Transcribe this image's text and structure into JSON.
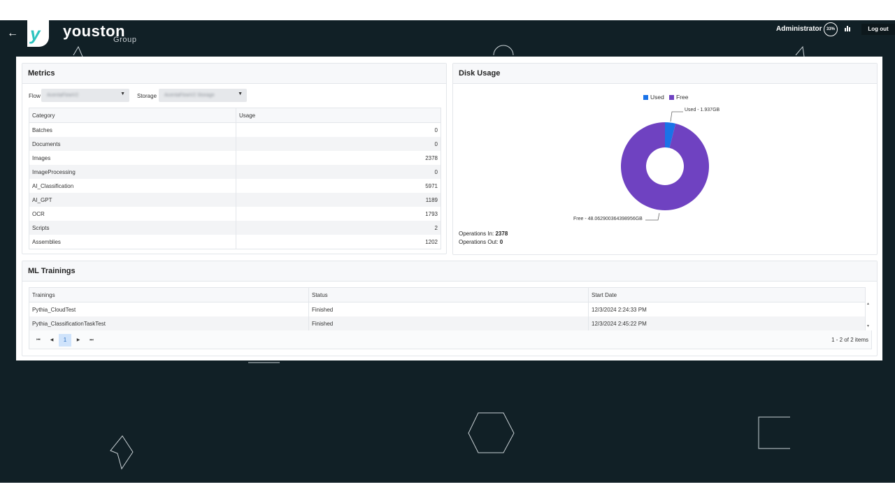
{
  "header": {
    "brand": "youston",
    "brand_sub": "Group",
    "user": "Administrator",
    "progress": "33%",
    "logout": "Log out"
  },
  "colors": {
    "app_bg": "#112026",
    "used": "#1a73e8",
    "free": "#6f42c1",
    "accent": "#2ec4c0"
  },
  "metrics": {
    "title": "Metrics",
    "flow_label": "Flow",
    "flow_value": "AcentaFlowV2",
    "storage_label": "Storage",
    "storage_value": "AcentaFlowV2 Storage",
    "columns": [
      "Category",
      "Usage"
    ],
    "rows": [
      [
        "Batches",
        "0"
      ],
      [
        "Documents",
        "0"
      ],
      [
        "Images",
        "2378"
      ],
      [
        "ImageProcessing",
        "0"
      ],
      [
        "AI_Classification",
        "5971"
      ],
      [
        "AI_GPT",
        "1189"
      ],
      [
        "OCR",
        "1793"
      ],
      [
        "Scripts",
        "2"
      ],
      [
        "Assemblies",
        "1202"
      ]
    ]
  },
  "disk": {
    "title": "Disk Usage",
    "legend_used": "Used",
    "legend_free": "Free",
    "label_used": "Used - 1.937GB",
    "label_free": "Free - 48.062900364398956GB",
    "ops_in_label": "Operations In:",
    "ops_in_value": "2378",
    "ops_out_label": "Operations Out:",
    "ops_out_value": "0"
  },
  "chart_data": {
    "type": "pie",
    "categories": [
      "Used",
      "Free"
    ],
    "values": [
      1.937,
      48.062900364398956
    ],
    "legend": "top"
  },
  "ml": {
    "title": "ML Trainings",
    "columns": [
      "Trainings",
      "Status",
      "Start Date"
    ],
    "rows": [
      [
        "Pythia_CloudTest",
        "Finished",
        "12/3/2024 2:24:33 PM"
      ],
      [
        "Pythia_ClassificationTaskTest",
        "Finished",
        "12/3/2024 2:45:22 PM"
      ]
    ],
    "page": "1",
    "page_info": "1 - 2 of 2 items"
  }
}
